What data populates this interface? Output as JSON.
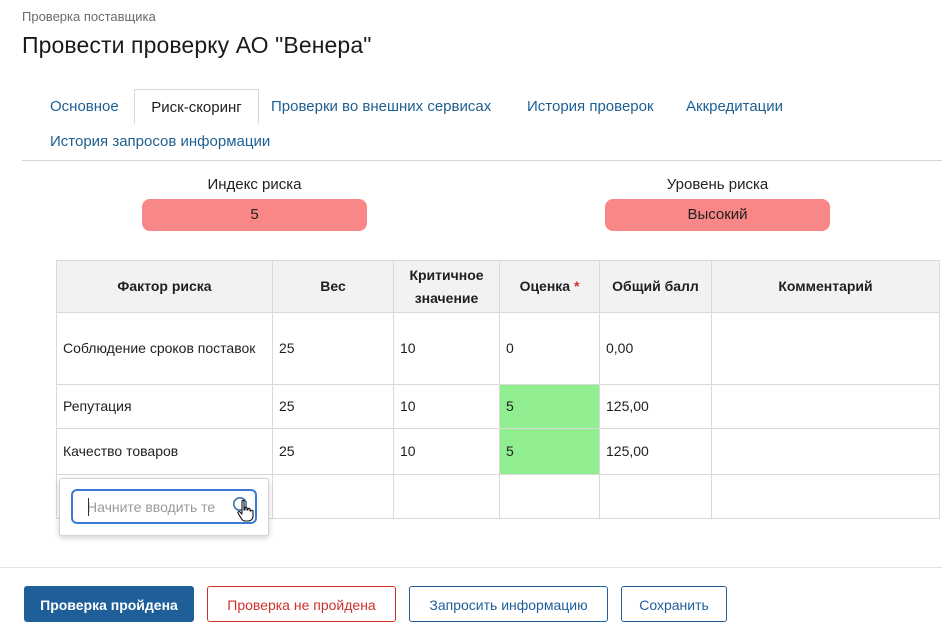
{
  "breadcrumb": "Проверка поставщика",
  "title": "Провести проверку АО \"Венера\"",
  "tabs": {
    "row1": [
      "Основное",
      "Риск-скоринг",
      "Проверки во внешних сервисах",
      "История проверок",
      "Аккредитации"
    ],
    "row2": [
      "История запросов информации"
    ],
    "active": "Риск-скоринг"
  },
  "risk": {
    "index_label": "Индекс риска",
    "index_value": "5",
    "level_label": "Уровень риска",
    "level_value": "Высокий",
    "pill_color": "#f98787"
  },
  "table": {
    "headers": [
      "Фактор риска",
      "Вес",
      "Критичное значение",
      "Оценка",
      "Общий балл",
      "Комментарий"
    ],
    "required_mark": "*",
    "rows": [
      [
        "Соблюдение сроков поставок",
        "25",
        "10",
        "0",
        "0,00",
        ""
      ],
      [
        "Репутация",
        "25",
        "10",
        "5",
        "125,00",
        ""
      ],
      [
        "Качество товаров",
        "25",
        "10",
        "5",
        "125,00",
        ""
      ]
    ],
    "highlight_color": "#90ee90"
  },
  "lookup": {
    "placeholder": "Начните вводить те",
    "icon": "search-icon"
  },
  "buttons": {
    "passed": "Проверка пройдена",
    "failed": "Проверка не пройдена",
    "request": "Запросить информацию",
    "save": "Сохранить"
  }
}
